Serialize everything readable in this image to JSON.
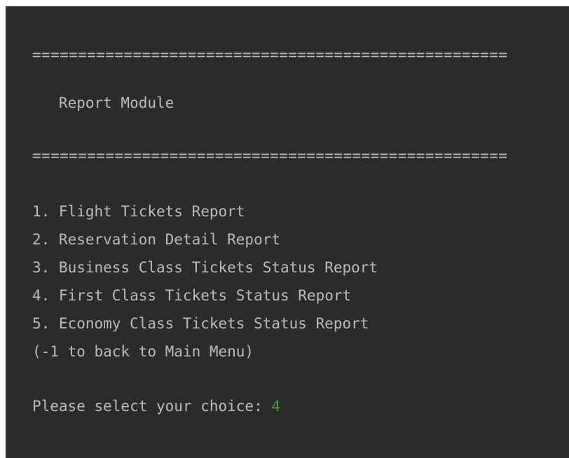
{
  "console": {
    "separator_top": "====================================================",
    "title": "   Report Module",
    "separator_bottom": "====================================================",
    "menu_items": [
      "1. Flight Tickets Report",
      "2. Reservation Detail Report",
      "3. Business Class Tickets Status Report",
      "4. First Class Tickets Status Report",
      "5. Economy Class Tickets Status Report"
    ],
    "back_hint": "(-1 to back to Main Menu)",
    "prompt": "Please select your choice: ",
    "input_value": "4",
    "colors": {
      "background": "#2b2b2b",
      "text": "#bbbbbb",
      "user_input": "#3ba53b"
    }
  }
}
